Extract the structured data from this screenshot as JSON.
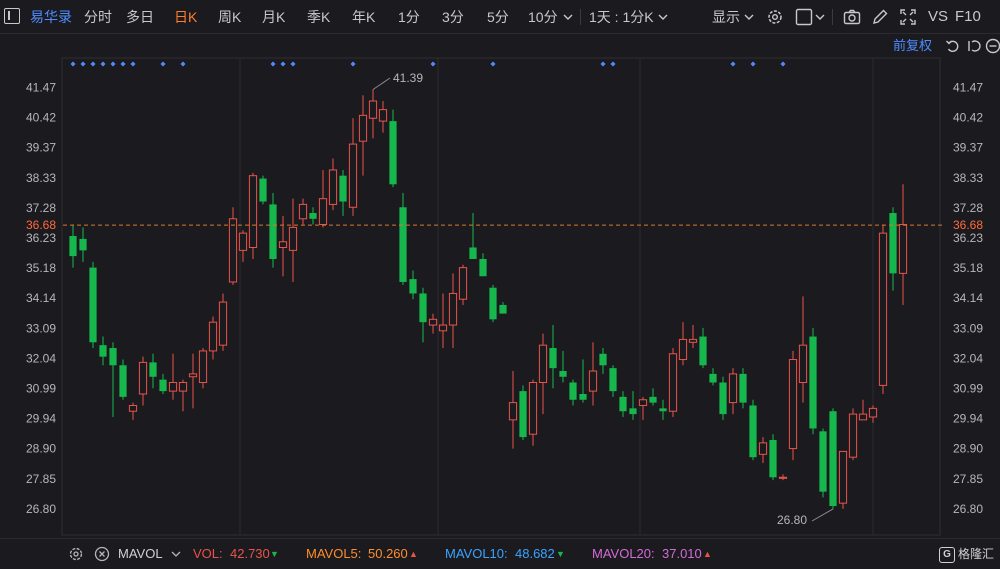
{
  "toolbar": {
    "stock_name": "易华录",
    "periods": [
      "分时",
      "多日",
      "日K",
      "周K",
      "月K",
      "季K",
      "年K",
      "1分",
      "3分",
      "5分",
      "10分"
    ],
    "active_period": "日K",
    "combo": "1天 : 1分K",
    "display_label": "显示",
    "vs_label": "VS",
    "f10_label": "F10",
    "adjust_label": "前复权"
  },
  "colors": {
    "up": "#e8534a",
    "down": "#16b84e",
    "accent": "#ff7d2d",
    "link": "#4f8cff",
    "marker": "#4f8cff",
    "price_line": "#d9792b",
    "mavol5": "#ff8c2e",
    "mavol10": "#3aa3ff",
    "mavol20": "#d46ad9"
  },
  "chart_data": {
    "type": "candlestick",
    "title": "",
    "ylim": [
      26.3,
      42.0
    ],
    "yticks": [
      "41.47",
      "40.42",
      "39.37",
      "38.33",
      "37.28",
      "36.23",
      "35.18",
      "34.14",
      "33.09",
      "32.04",
      "30.99",
      "29.94",
      "28.90",
      "27.85",
      "26.80"
    ],
    "current_price": "36.68",
    "high_annotation": "41.39",
    "low_annotation": "26.80",
    "event_markers_on_candles": [
      0,
      1,
      2,
      3,
      4,
      5,
      6,
      9,
      11,
      20,
      21,
      22,
      28,
      36,
      42,
      53,
      54,
      66,
      68,
      71
    ],
    "candles": [
      {
        "o": 36.3,
        "h": 36.7,
        "l": 35.2,
        "c": 35.6
      },
      {
        "o": 36.2,
        "h": 36.6,
        "l": 35.4,
        "c": 35.8
      },
      {
        "o": 35.2,
        "h": 35.4,
        "l": 32.4,
        "c": 32.6
      },
      {
        "o": 32.5,
        "h": 32.8,
        "l": 31.8,
        "c": 32.1
      },
      {
        "o": 32.4,
        "h": 32.6,
        "l": 30.0,
        "c": 31.8
      },
      {
        "o": 31.8,
        "h": 32.0,
        "l": 30.6,
        "c": 30.7
      },
      {
        "o": 30.2,
        "h": 30.5,
        "l": 29.9,
        "c": 30.4
      },
      {
        "o": 30.8,
        "h": 32.1,
        "l": 30.4,
        "c": 31.9
      },
      {
        "o": 31.9,
        "h": 32.2,
        "l": 31.0,
        "c": 31.4
      },
      {
        "o": 31.3,
        "h": 31.5,
        "l": 30.8,
        "c": 30.9
      },
      {
        "o": 30.9,
        "h": 32.2,
        "l": 30.6,
        "c": 31.2
      },
      {
        "o": 30.9,
        "h": 31.3,
        "l": 30.2,
        "c": 31.2
      },
      {
        "o": 31.4,
        "h": 32.2,
        "l": 30.3,
        "c": 31.5
      },
      {
        "o": 31.2,
        "h": 32.4,
        "l": 31.0,
        "c": 32.3
      },
      {
        "o": 32.3,
        "h": 33.5,
        "l": 32.0,
        "c": 33.3
      },
      {
        "o": 32.5,
        "h": 34.3,
        "l": 32.3,
        "c": 34.0
      },
      {
        "o": 34.7,
        "h": 37.3,
        "l": 34.6,
        "c": 36.9
      },
      {
        "o": 35.8,
        "h": 36.5,
        "l": 35.4,
        "c": 36.4
      },
      {
        "o": 35.9,
        "h": 38.5,
        "l": 35.5,
        "c": 38.4
      },
      {
        "o": 38.3,
        "h": 38.4,
        "l": 37.4,
        "c": 37.5
      },
      {
        "o": 37.4,
        "h": 37.8,
        "l": 35.2,
        "c": 35.5
      },
      {
        "o": 35.9,
        "h": 37.0,
        "l": 34.9,
        "c": 36.1
      },
      {
        "o": 35.8,
        "h": 37.6,
        "l": 34.7,
        "c": 36.6
      },
      {
        "o": 36.9,
        "h": 37.6,
        "l": 36.7,
        "c": 37.4
      },
      {
        "o": 37.1,
        "h": 37.3,
        "l": 36.7,
        "c": 36.9
      },
      {
        "o": 36.7,
        "h": 38.6,
        "l": 36.6,
        "c": 37.6
      },
      {
        "o": 37.4,
        "h": 39.0,
        "l": 37.2,
        "c": 38.6
      },
      {
        "o": 38.4,
        "h": 38.6,
        "l": 37.0,
        "c": 37.5
      },
      {
        "o": 37.3,
        "h": 40.4,
        "l": 37.0,
        "c": 39.5
      },
      {
        "o": 39.6,
        "h": 41.2,
        "l": 38.4,
        "c": 40.5
      },
      {
        "o": 40.4,
        "h": 41.4,
        "l": 39.7,
        "c": 41.0
      },
      {
        "o": 40.3,
        "h": 41.0,
        "l": 39.9,
        "c": 40.7
      },
      {
        "o": 40.3,
        "h": 40.7,
        "l": 38.0,
        "c": 38.1
      },
      {
        "o": 37.3,
        "h": 37.8,
        "l": 34.6,
        "c": 34.7
      },
      {
        "o": 34.8,
        "h": 35.1,
        "l": 34.1,
        "c": 34.3
      },
      {
        "o": 34.3,
        "h": 34.5,
        "l": 32.6,
        "c": 33.3
      },
      {
        "o": 33.2,
        "h": 33.6,
        "l": 32.9,
        "c": 33.4
      },
      {
        "o": 33.0,
        "h": 34.3,
        "l": 32.4,
        "c": 33.2
      },
      {
        "o": 33.2,
        "h": 35.0,
        "l": 32.4,
        "c": 34.3
      },
      {
        "o": 34.1,
        "h": 35.3,
        "l": 33.9,
        "c": 35.2
      },
      {
        "o": 35.9,
        "h": 37.1,
        "l": 35.6,
        "c": 35.5
      },
      {
        "o": 35.5,
        "h": 35.7,
        "l": 34.9,
        "c": 34.9
      },
      {
        "o": 34.5,
        "h": 34.6,
        "l": 33.3,
        "c": 33.4
      },
      {
        "o": 33.9,
        "h": 34.0,
        "l": 33.6,
        "c": 33.6
      },
      {
        "o": 29.9,
        "h": 31.6,
        "l": 28.9,
        "c": 30.5
      },
      {
        "o": 30.9,
        "h": 31.1,
        "l": 29.2,
        "c": 29.3
      },
      {
        "o": 29.4,
        "h": 31.3,
        "l": 29.0,
        "c": 31.2
      },
      {
        "o": 31.2,
        "h": 32.9,
        "l": 30.1,
        "c": 32.5
      },
      {
        "o": 32.4,
        "h": 33.2,
        "l": 31.0,
        "c": 31.7
      },
      {
        "o": 31.6,
        "h": 32.3,
        "l": 31.2,
        "c": 31.4
      },
      {
        "o": 31.2,
        "h": 31.3,
        "l": 30.4,
        "c": 30.6
      },
      {
        "o": 30.8,
        "h": 32.0,
        "l": 30.5,
        "c": 30.6
      },
      {
        "o": 30.9,
        "h": 32.6,
        "l": 30.4,
        "c": 31.6
      },
      {
        "o": 32.2,
        "h": 32.4,
        "l": 31.5,
        "c": 31.8
      },
      {
        "o": 31.7,
        "h": 31.8,
        "l": 30.7,
        "c": 30.9
      },
      {
        "o": 30.7,
        "h": 30.9,
        "l": 30.0,
        "c": 30.2
      },
      {
        "o": 30.3,
        "h": 30.9,
        "l": 29.9,
        "c": 30.1
      },
      {
        "o": 30.4,
        "h": 30.7,
        "l": 29.9,
        "c": 30.6
      },
      {
        "o": 30.7,
        "h": 31.0,
        "l": 30.4,
        "c": 30.5
      },
      {
        "o": 30.3,
        "h": 30.6,
        "l": 29.9,
        "c": 30.2
      },
      {
        "o": 30.2,
        "h": 32.4,
        "l": 30.0,
        "c": 32.2
      },
      {
        "o": 32.0,
        "h": 33.3,
        "l": 31.8,
        "c": 32.7
      },
      {
        "o": 32.6,
        "h": 33.2,
        "l": 32.4,
        "c": 32.7
      },
      {
        "o": 32.8,
        "h": 33.1,
        "l": 31.7,
        "c": 31.8
      },
      {
        "o": 31.5,
        "h": 31.7,
        "l": 31.1,
        "c": 31.2
      },
      {
        "o": 31.2,
        "h": 31.4,
        "l": 29.9,
        "c": 30.1
      },
      {
        "o": 30.5,
        "h": 31.7,
        "l": 30.1,
        "c": 31.5
      },
      {
        "o": 31.5,
        "h": 31.7,
        "l": 30.3,
        "c": 30.5
      },
      {
        "o": 30.4,
        "h": 30.6,
        "l": 28.5,
        "c": 28.6
      },
      {
        "o": 28.7,
        "h": 29.3,
        "l": 28.4,
        "c": 29.1
      },
      {
        "o": 29.2,
        "h": 29.4,
        "l": 27.8,
        "c": 27.9
      },
      {
        "o": 27.9,
        "h": 28.0,
        "l": 27.8,
        "c": 27.9
      },
      {
        "o": 28.9,
        "h": 32.3,
        "l": 28.5,
        "c": 32.0
      },
      {
        "o": 31.2,
        "h": 34.2,
        "l": 30.5,
        "c": 32.5
      },
      {
        "o": 32.8,
        "h": 33.1,
        "l": 29.4,
        "c": 29.6
      },
      {
        "o": 29.5,
        "h": 29.6,
        "l": 27.2,
        "c": 27.4
      },
      {
        "o": 30.2,
        "h": 30.3,
        "l": 26.8,
        "c": 26.9
      },
      {
        "o": 27.0,
        "h": 28.8,
        "l": 26.8,
        "c": 28.8
      },
      {
        "o": 28.6,
        "h": 30.3,
        "l": 28.5,
        "c": 30.1
      },
      {
        "o": 29.9,
        "h": 30.6,
        "l": 29.9,
        "c": 30.1
      },
      {
        "o": 30.0,
        "h": 30.4,
        "l": 29.8,
        "c": 30.3
      },
      {
        "o": 31.1,
        "h": 36.7,
        "l": 30.8,
        "c": 36.4
      },
      {
        "o": 37.1,
        "h": 37.3,
        "l": 34.4,
        "c": 35.0
      },
      {
        "o": 35.0,
        "h": 38.1,
        "l": 33.9,
        "c": 36.7
      }
    ]
  },
  "indicators": {
    "name": "MAVOL",
    "vol_label": "VOL:",
    "vol_value": "42.730",
    "vol_dir": "▼",
    "mavol5_label": "MAVOL5:",
    "mavol5_value": "50.260",
    "mavol5_dir": "▲",
    "mavol10_label": "MAVOL10:",
    "mavol10_value": "48.682",
    "mavol10_dir": "▼",
    "mavol20_label": "MAVOL20:",
    "mavol20_value": "37.010",
    "mavol20_dir": "▲"
  },
  "brand": "格隆汇"
}
